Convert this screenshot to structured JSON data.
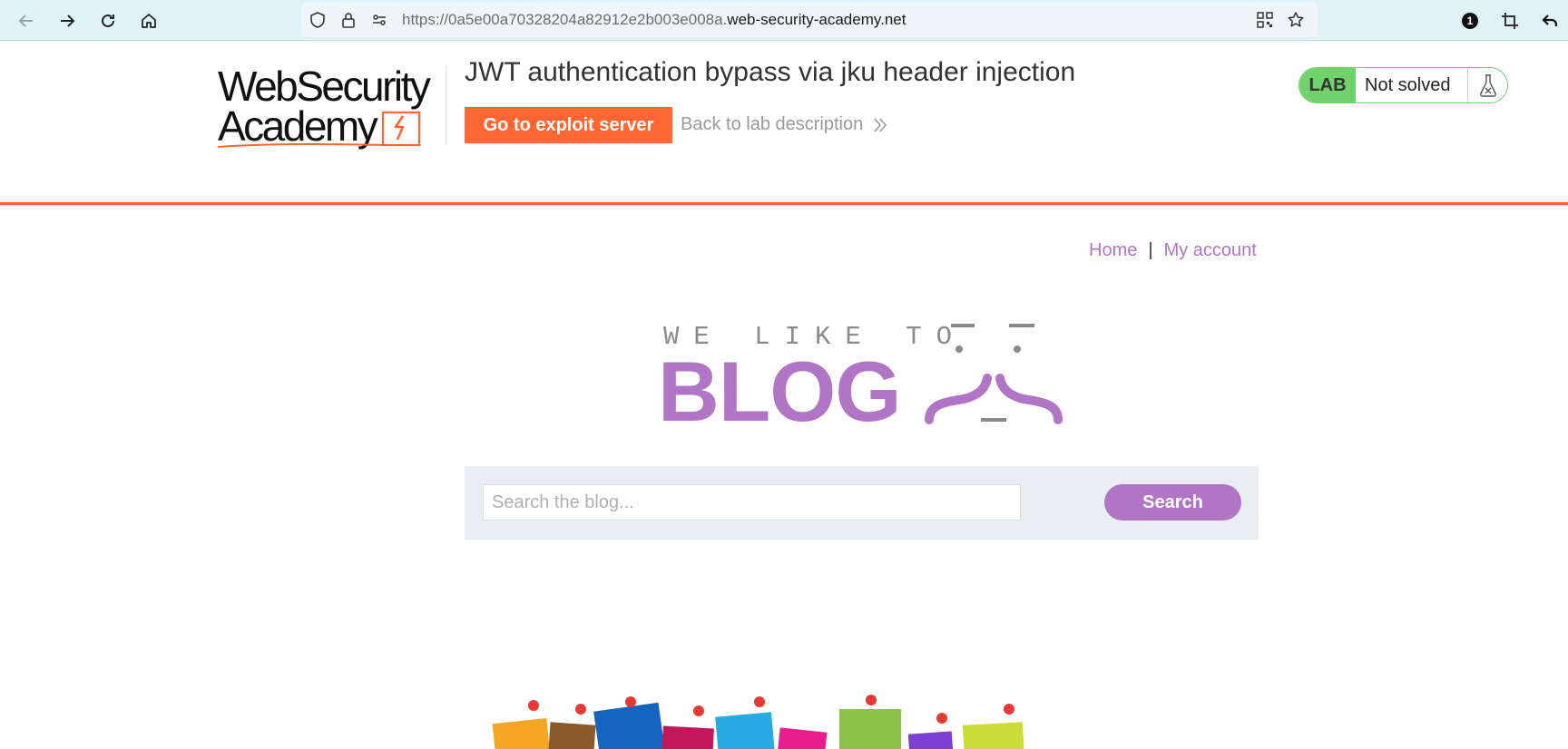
{
  "browser": {
    "url_prefix": "https://0a5e00a70328204a82912e2b003e008a.",
    "url_domain": "web-security-academy.net",
    "notification_count": "1"
  },
  "lab": {
    "logo_line1": "WebSecurity",
    "logo_line2": "Academy",
    "title": "JWT authentication bypass via jku header injection",
    "exploit_button": "Go to exploit server",
    "back_link": "Back to lab description",
    "badge": "LAB",
    "status": "Not solved"
  },
  "nav": {
    "home": "Home",
    "separator": "|",
    "account": "My account"
  },
  "banner": {
    "tagline": "WE LIKE TO",
    "word": "BLOG"
  },
  "search": {
    "placeholder": "Search the blog...",
    "button": "Search"
  },
  "colors": {
    "accent_orange": "#ff6633",
    "blog_purple": "#b175c6",
    "lab_green": "#70d16d"
  }
}
